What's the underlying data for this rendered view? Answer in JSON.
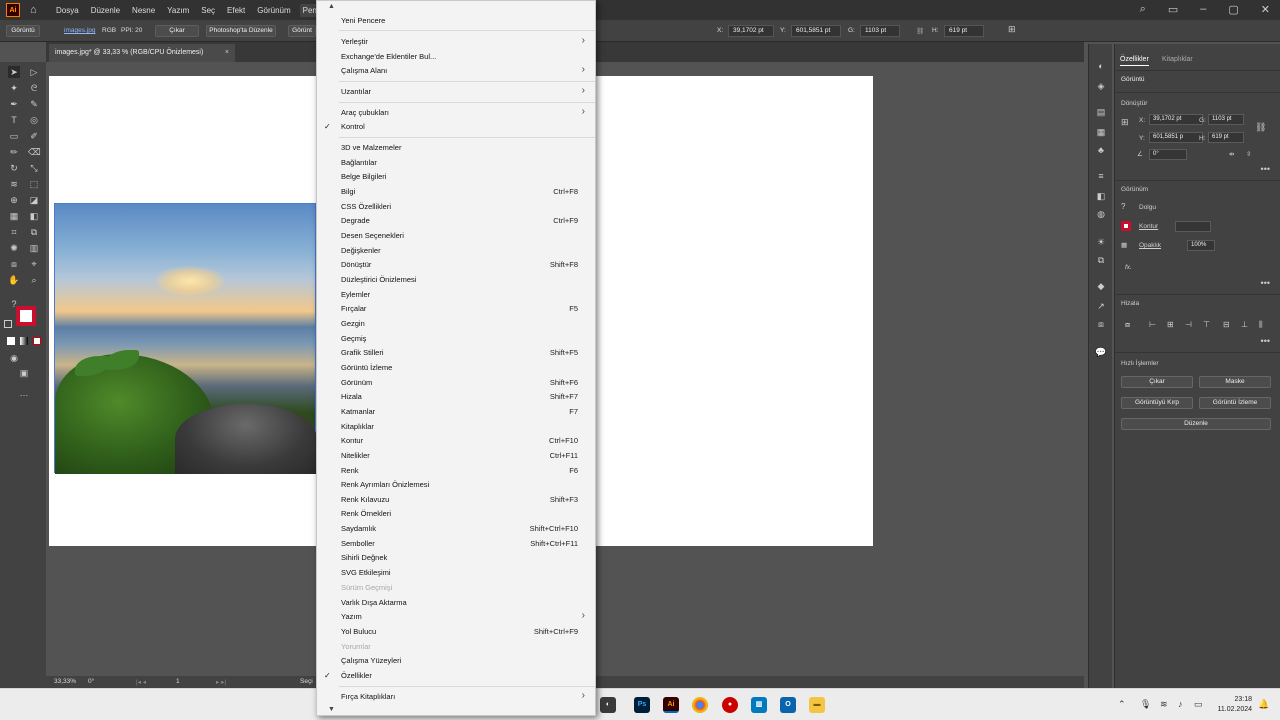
{
  "menubar": {
    "logo": "Ai",
    "items": [
      "Dosya",
      "Düzenle",
      "Nesne",
      "Yazım",
      "Seç",
      "Efekt",
      "Görünüm",
      "Pencere"
    ]
  },
  "control_bar": {
    "appearance_btn": "Görüntü",
    "filename": "images.jpg",
    "color_mode": "RGB",
    "ppi": "PPI: 20",
    "embed_btn": "Çıkar",
    "edit_ps_btn": "Photoshop'ta Düzenle",
    "trace_btn": "Görünt",
    "x_label": "X:",
    "x_value": "39,1702 pt",
    "y_label": "Y:",
    "y_value": "601,5851 pt",
    "w_label": "G:",
    "w_value": "1103 pt",
    "h_label": "H:",
    "h_value": "619 pt"
  },
  "doc_tab": {
    "title": "images.jpg* @ 33,33 % (RGB/CPU Önizlemesi)",
    "close": "×"
  },
  "dropdown_menu": {
    "top_arrow": "▲",
    "bottom_arrow": "▼",
    "items": [
      {
        "label": "Yeni Pencere",
        "shortcut": "",
        "submenu": false,
        "checked": false,
        "disabled": false
      },
      {
        "label": "Yerleştir",
        "shortcut": "",
        "submenu": true,
        "checked": false,
        "disabled": false
      },
      {
        "label": "Exchange'de Eklentiler Bul...",
        "shortcut": "",
        "submenu": false,
        "checked": false,
        "disabled": false
      },
      {
        "label": "Çalışma Alanı",
        "shortcut": "",
        "submenu": true,
        "checked": false,
        "disabled": false
      },
      {
        "label": "Uzantılar",
        "shortcut": "",
        "submenu": true,
        "checked": false,
        "disabled": false
      },
      {
        "label": "Araç çubukları",
        "shortcut": "",
        "submenu": true,
        "checked": false,
        "disabled": false
      },
      {
        "label": "Kontrol",
        "shortcut": "",
        "submenu": false,
        "checked": true,
        "disabled": false
      },
      {
        "label": "3D ve Malzemeler",
        "shortcut": "",
        "submenu": false,
        "checked": false,
        "disabled": false
      },
      {
        "label": "Bağlantılar",
        "shortcut": "",
        "submenu": false,
        "checked": false,
        "disabled": false
      },
      {
        "label": "Belge Bilgileri",
        "shortcut": "",
        "submenu": false,
        "checked": false,
        "disabled": false
      },
      {
        "label": "Bilgi",
        "shortcut": "Ctrl+F8",
        "submenu": false,
        "checked": false,
        "disabled": false
      },
      {
        "label": "CSS Özellikleri",
        "shortcut": "",
        "submenu": false,
        "checked": false,
        "disabled": false
      },
      {
        "label": "Degrade",
        "shortcut": "Ctrl+F9",
        "submenu": false,
        "checked": false,
        "disabled": false
      },
      {
        "label": "Desen Seçenekleri",
        "shortcut": "",
        "submenu": false,
        "checked": false,
        "disabled": false
      },
      {
        "label": "Değişkenler",
        "shortcut": "",
        "submenu": false,
        "checked": false,
        "disabled": false
      },
      {
        "label": "Dönüştür",
        "shortcut": "Shift+F8",
        "submenu": false,
        "checked": false,
        "disabled": false
      },
      {
        "label": "Düzleştirici Önizlemesi",
        "shortcut": "",
        "submenu": false,
        "checked": false,
        "disabled": false
      },
      {
        "label": "Eylemler",
        "shortcut": "",
        "submenu": false,
        "checked": false,
        "disabled": false
      },
      {
        "label": "Fırçalar",
        "shortcut": "F5",
        "submenu": false,
        "checked": false,
        "disabled": false
      },
      {
        "label": "Gezgin",
        "shortcut": "",
        "submenu": false,
        "checked": false,
        "disabled": false
      },
      {
        "label": "Geçmiş",
        "shortcut": "",
        "submenu": false,
        "checked": false,
        "disabled": false
      },
      {
        "label": "Grafik Stilleri",
        "shortcut": "Shift+F5",
        "submenu": false,
        "checked": false,
        "disabled": false
      },
      {
        "label": "Görüntü İzleme",
        "shortcut": "",
        "submenu": false,
        "checked": false,
        "disabled": false
      },
      {
        "label": "Görünüm",
        "shortcut": "Shift+F6",
        "submenu": false,
        "checked": false,
        "disabled": false
      },
      {
        "label": "Hizala",
        "shortcut": "Shift+F7",
        "submenu": false,
        "checked": false,
        "disabled": false
      },
      {
        "label": "Katmanlar",
        "shortcut": "F7",
        "submenu": false,
        "checked": false,
        "disabled": false
      },
      {
        "label": "Kitaplıklar",
        "shortcut": "",
        "submenu": false,
        "checked": false,
        "disabled": false
      },
      {
        "label": "Kontur",
        "shortcut": "Ctrl+F10",
        "submenu": false,
        "checked": false,
        "disabled": false
      },
      {
        "label": "Nitelikler",
        "shortcut": "Ctrl+F11",
        "submenu": false,
        "checked": false,
        "disabled": false
      },
      {
        "label": "Renk",
        "shortcut": "F6",
        "submenu": false,
        "checked": false,
        "disabled": false
      },
      {
        "label": "Renk Ayrımları Önizlemesi",
        "shortcut": "",
        "submenu": false,
        "checked": false,
        "disabled": false
      },
      {
        "label": "Renk Kılavuzu",
        "shortcut": "Shift+F3",
        "submenu": false,
        "checked": false,
        "disabled": false
      },
      {
        "label": "Renk Örnekleri",
        "shortcut": "",
        "submenu": false,
        "checked": false,
        "disabled": false
      },
      {
        "label": "Saydamlık",
        "shortcut": "Shift+Ctrl+F10",
        "submenu": false,
        "checked": false,
        "disabled": false
      },
      {
        "label": "Semboller",
        "shortcut": "Shift+Ctrl+F11",
        "submenu": false,
        "checked": false,
        "disabled": false
      },
      {
        "label": "Sihirli Değnek",
        "shortcut": "",
        "submenu": false,
        "checked": false,
        "disabled": false
      },
      {
        "label": "SVG Etkileşimi",
        "shortcut": "",
        "submenu": false,
        "checked": false,
        "disabled": false
      },
      {
        "label": "Sürüm Geçmişi",
        "shortcut": "",
        "submenu": false,
        "checked": false,
        "disabled": true
      },
      {
        "label": "Varlık Dışa Aktarma",
        "shortcut": "",
        "submenu": false,
        "checked": false,
        "disabled": false
      },
      {
        "label": "Yazım",
        "shortcut": "",
        "submenu": true,
        "checked": false,
        "disabled": false
      },
      {
        "label": "Yol Bulucu",
        "shortcut": "Shift+Ctrl+F9",
        "submenu": false,
        "checked": false,
        "disabled": false
      },
      {
        "label": "Yorumlar",
        "shortcut": "",
        "submenu": false,
        "checked": false,
        "disabled": true
      },
      {
        "label": "Çalışma Yüzeyleri",
        "shortcut": "",
        "submenu": false,
        "checked": false,
        "disabled": false
      },
      {
        "label": "Özellikler",
        "shortcut": "",
        "submenu": false,
        "checked": true,
        "disabled": false
      },
      {
        "label": "Fırça Kitaplıkları",
        "shortcut": "",
        "submenu": true,
        "checked": false,
        "disabled": false
      }
    ]
  },
  "properties_panel": {
    "tab_properties": "Özellikler",
    "tab_libraries": "Kitaplıklar",
    "object_type": "Görüntü",
    "transform_title": "Dönüştür",
    "x_label": "X:",
    "x_value": "39,1702 pt",
    "w_label": "G:",
    "w_value": "1103 pt",
    "y_label": "Y:",
    "y_value": "601,5851 p",
    "h_label": "H:",
    "h_value": "619 pt",
    "rotate_value": "0°",
    "appearance_title": "Görünüm",
    "fill_label": "Dolgu",
    "stroke_label": "Kontur",
    "opacity_label": "Opaklık",
    "opacity_value": "100%",
    "fx_label": "fx.",
    "align_title": "Hizala",
    "quick_actions_title": "Hızlı İşlemler",
    "btn_embed": "Çıkar",
    "btn_mask": "Maske",
    "btn_crop": "Görüntüyü Kırp",
    "btn_trace": "Görüntü İzleme",
    "btn_arrange": "Düzenle"
  },
  "status_bar": {
    "zoom": "33,33%",
    "rotation": "0°",
    "artboard_num": "1",
    "status_text": "Seçi"
  },
  "taskbar": {
    "time": "23:18",
    "date": "11.02.2024",
    "apps": [
      "Ps",
      "Ai"
    ]
  }
}
